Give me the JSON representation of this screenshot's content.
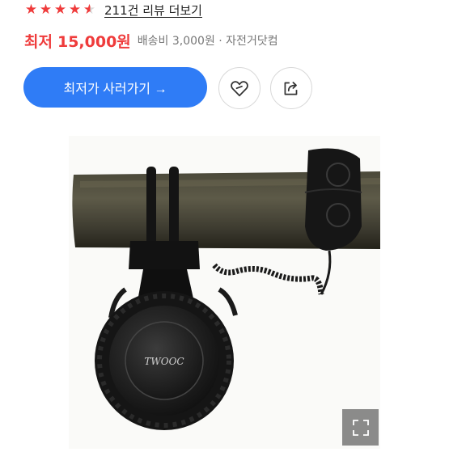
{
  "rating": {
    "stars": [
      "full",
      "full",
      "full",
      "full",
      "half"
    ],
    "review_link": "211건 리뷰 더보기"
  },
  "price": {
    "label": "최저",
    "value": "15,000원",
    "shipping": "배송비 3,000원 · 자전거닷컴"
  },
  "actions": {
    "buy_label": "최저가 사러가기 →",
    "wishlist_icon": "heart-icon",
    "share_icon": "share-icon"
  },
  "product_image": {
    "logo_text": "TWOOC",
    "expand_icon": "expand-icon"
  },
  "colors": {
    "accent_red": "#ef3b3b",
    "primary_blue": "#2f7cf6"
  }
}
